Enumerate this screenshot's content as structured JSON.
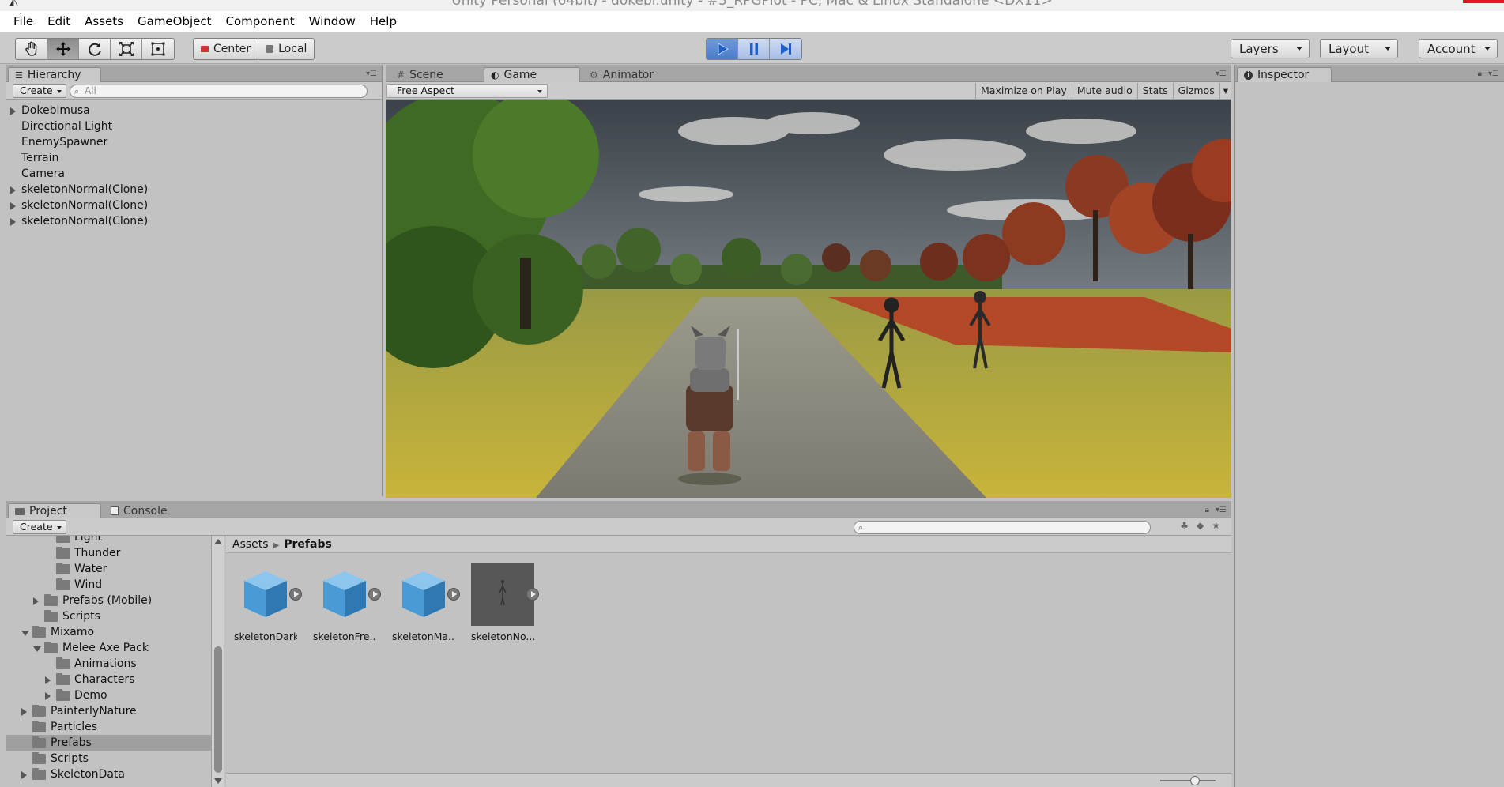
{
  "window": {
    "title": "Unity Personal (64bit) - dokebi.unity - #3_RPGPlot - PC, Mac & Linux Standalone <DX11>"
  },
  "menubar": {
    "items": [
      "File",
      "Edit",
      "Assets",
      "GameObject",
      "Component",
      "Window",
      "Help"
    ]
  },
  "toolbar": {
    "tools": [
      "hand-tool",
      "move-tool",
      "rotate-tool",
      "scale-tool",
      "rect-tool"
    ],
    "active_tool": "move-tool",
    "pivot_label": "Center",
    "space_label": "Local",
    "layers_label": "Layers",
    "layout_label": "Layout",
    "account_label": "Account",
    "play_state": "playing"
  },
  "hierarchy": {
    "tab_label": "Hierarchy",
    "create_label": "Create",
    "search_placeholder": "All",
    "items": [
      {
        "label": "Dokebimusa",
        "expandable": true
      },
      {
        "label": "Directional Light",
        "expandable": false
      },
      {
        "label": "EnemySpawner",
        "expandable": false
      },
      {
        "label": "Terrain",
        "expandable": false
      },
      {
        "label": "Camera",
        "expandable": false
      },
      {
        "label": "skeletonNormal(Clone)",
        "expandable": true
      },
      {
        "label": "skeletonNormal(Clone)",
        "expandable": true
      },
      {
        "label": "skeletonNormal(Clone)",
        "expandable": true
      }
    ]
  },
  "center": {
    "tabs": {
      "scene": "Scene",
      "game": "Game",
      "animator": "Animator"
    },
    "active_tab": "Game",
    "aspect_label": "Free Aspect",
    "buttons": {
      "maximize": "Maximize on Play",
      "mute": "Mute audio",
      "stats": "Stats",
      "gizmos": "Gizmos"
    }
  },
  "inspector": {
    "tab_label": "Inspector"
  },
  "project": {
    "tabs": {
      "project": "Project",
      "console": "Console"
    },
    "create_label": "Create",
    "breadcrumb": {
      "root": "Assets",
      "current": "Prefabs"
    },
    "tree": [
      {
        "label": "Light",
        "indent": 3,
        "arrow": "none"
      },
      {
        "label": "Thunder",
        "indent": 3,
        "arrow": "none"
      },
      {
        "label": "Water",
        "indent": 3,
        "arrow": "none"
      },
      {
        "label": "Wind",
        "indent": 3,
        "arrow": "none"
      },
      {
        "label": "Prefabs (Mobile)",
        "indent": 2,
        "arrow": "right"
      },
      {
        "label": "Scripts",
        "indent": 2,
        "arrow": "none"
      },
      {
        "label": "Mixamo",
        "indent": 1,
        "arrow": "down"
      },
      {
        "label": "Melee Axe Pack",
        "indent": 2,
        "arrow": "down"
      },
      {
        "label": "Animations",
        "indent": 3,
        "arrow": "none"
      },
      {
        "label": "Characters",
        "indent": 3,
        "arrow": "right"
      },
      {
        "label": "Demo",
        "indent": 3,
        "arrow": "right"
      },
      {
        "label": "PainterlyNature",
        "indent": 1,
        "arrow": "right"
      },
      {
        "label": "Particles",
        "indent": 1,
        "arrow": "none"
      },
      {
        "label": "Prefabs",
        "indent": 1,
        "arrow": "none",
        "selected": true
      },
      {
        "label": "Scripts",
        "indent": 1,
        "arrow": "none"
      },
      {
        "label": "SkeletonData",
        "indent": 1,
        "arrow": "right"
      }
    ],
    "assets": [
      {
        "label": "skeletonDark",
        "kind": "prefab-cube",
        "selected": false
      },
      {
        "label": "skeletonFre...",
        "kind": "prefab-cube",
        "selected": false
      },
      {
        "label": "skeletonMa...",
        "kind": "prefab-cube",
        "selected": false
      },
      {
        "label": "skeletonNo...",
        "kind": "model-preview",
        "selected": true
      }
    ]
  },
  "colors": {
    "play_active": "#4c7bc9",
    "panel_bg": "#c2c2c2",
    "tab_bg": "#a5a5a5",
    "prefab_cube": "#4a9ad6"
  }
}
